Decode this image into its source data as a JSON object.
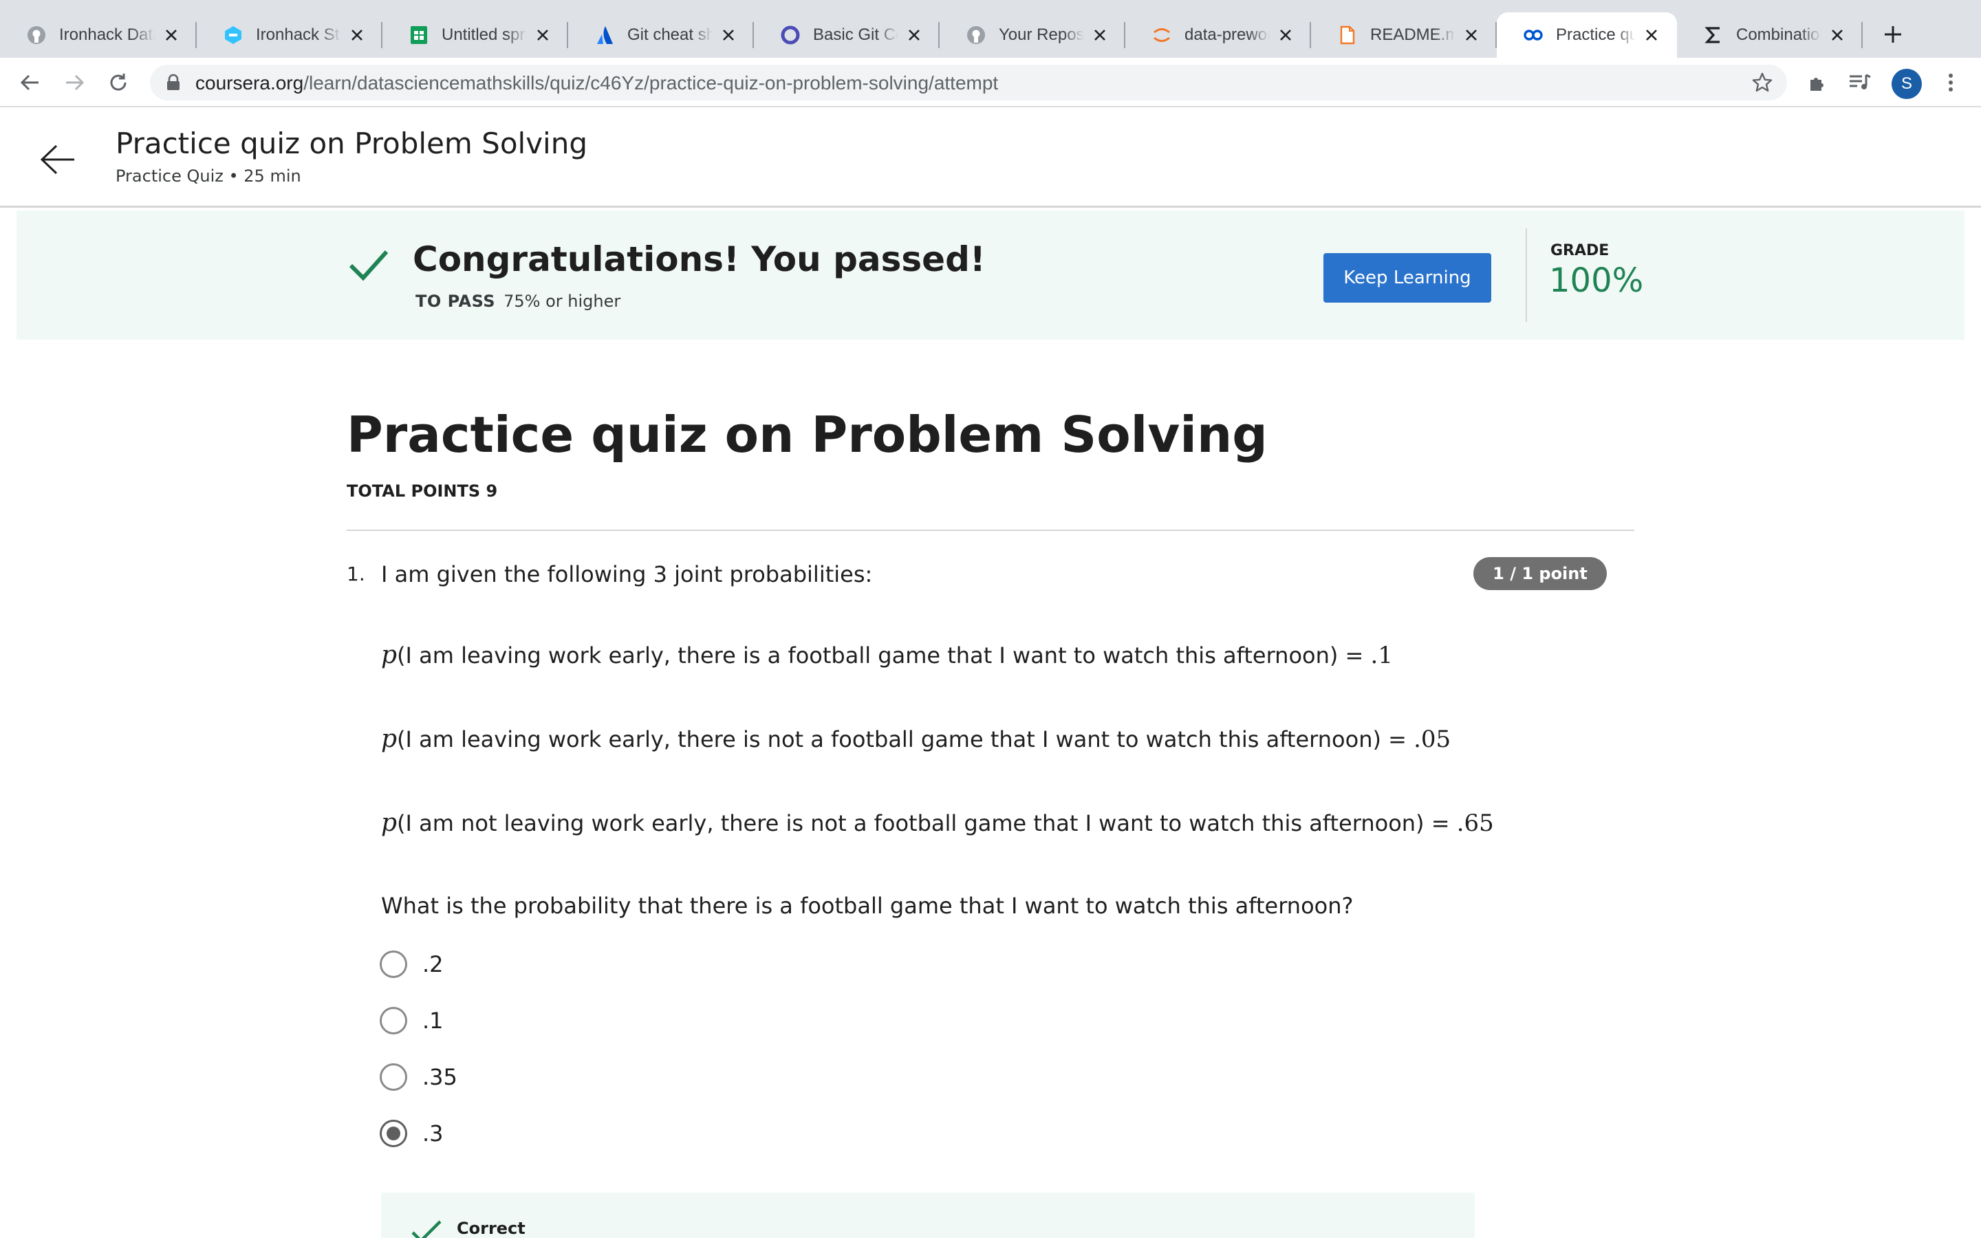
{
  "browser": {
    "tabs": [
      {
        "title": "Ironhack Data",
        "icon": "github-icon"
      },
      {
        "title": "Ironhack Stud",
        "icon": "ironhack-icon"
      },
      {
        "title": "Untitled spre",
        "icon": "sheets-icon"
      },
      {
        "title": "Git cheat she",
        "icon": "atlassian-icon"
      },
      {
        "title": "Basic Git Co",
        "icon": "circle-icon"
      },
      {
        "title": "Your Reposit",
        "icon": "github-icon"
      },
      {
        "title": "data-prework",
        "icon": "jupyter-icon"
      },
      {
        "title": "README.md",
        "icon": "file-icon"
      },
      {
        "title": "Practice quiz",
        "icon": "coursera-icon",
        "active": true
      },
      {
        "title": "Combination",
        "icon": "sigma-icon"
      }
    ],
    "url_host": "coursera.org",
    "url_path": "/learn/datasciencemathskills/quiz/c46Yz/practice-quiz-on-problem-solving/attempt",
    "profile_initial": "S"
  },
  "header": {
    "title": "Practice quiz on Problem Solving",
    "subtitle": "Practice Quiz • 25 min"
  },
  "banner": {
    "message": "Congratulations! You passed!",
    "to_pass_label": "TO PASS",
    "to_pass_value": "75% or higher",
    "button": "Keep Learning",
    "grade_label": "GRADE",
    "grade_value": "100%",
    "colors": {
      "accent_green": "#1f8354",
      "button_blue": "#2a73cc"
    }
  },
  "quiz": {
    "title": "Practice quiz on Problem Solving",
    "total_points": "TOTAL POINTS 9",
    "question": {
      "number": "1.",
      "intro": "I am given the following 3 joint probabilities:",
      "points": "1 / 1 point",
      "probabilities": [
        {
          "symbol": "p",
          "text": "(I am leaving work early, there is a football game that I want to watch this afternoon) = ",
          "value": ".1"
        },
        {
          "symbol": "p",
          "text": "(I am leaving work early, there is not a football game that I want to watch this afternoon) = ",
          "value": ".05"
        },
        {
          "symbol": "p",
          "text": "(I am not leaving work early, there is not a football game that I want to watch this afternoon) = ",
          "value": ".65"
        }
      ],
      "prompt": "What is the probability that there is a football game that I want to watch this afternoon?",
      "options": [
        {
          "label": ".2",
          "selected": false
        },
        {
          "label": ".1",
          "selected": false
        },
        {
          "label": ".35",
          "selected": false
        },
        {
          "label": ".3",
          "selected": true
        }
      ],
      "feedback": "Correct"
    }
  }
}
